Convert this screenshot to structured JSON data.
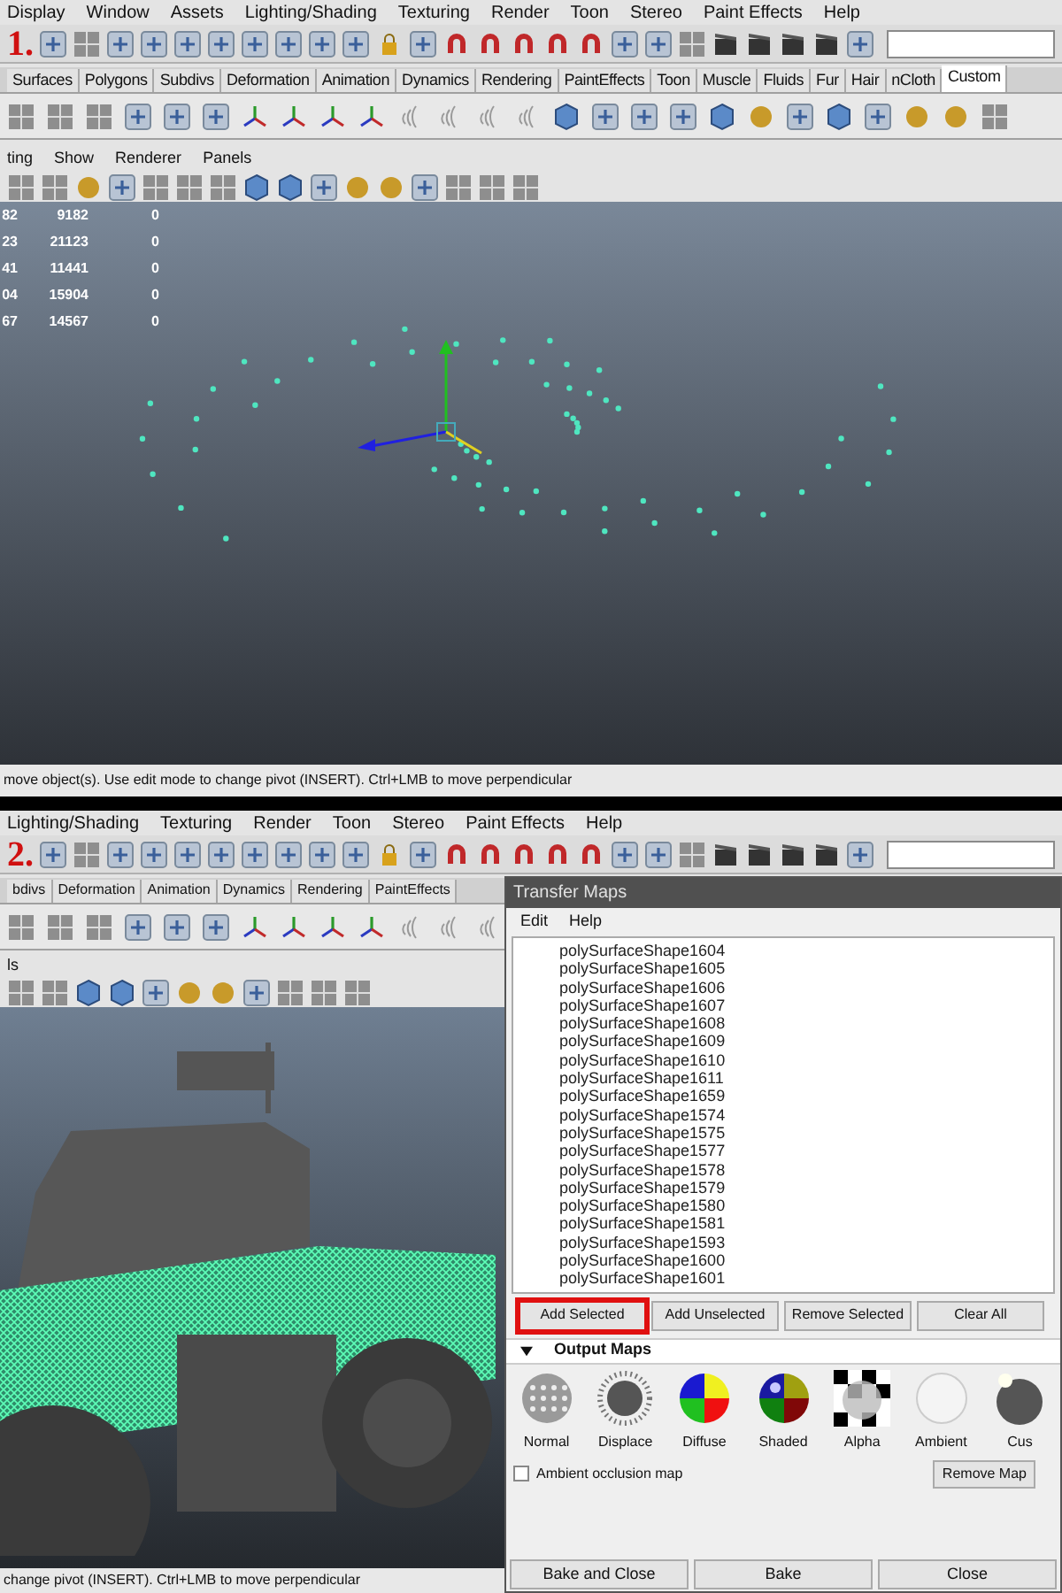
{
  "top_screen": {
    "annotation": "1.",
    "menu_bar": [
      "Display",
      "Window",
      "Assets",
      "Lighting/Shading",
      "Texturing",
      "Render",
      "Toon",
      "Stereo",
      "Paint Effects",
      "Help"
    ],
    "shelf_tabs": [
      {
        "label": "Surfaces",
        "selected": false
      },
      {
        "label": "Polygons",
        "selected": false
      },
      {
        "label": "Subdivs",
        "selected": false
      },
      {
        "label": "Deformation",
        "selected": false
      },
      {
        "label": "Animation",
        "selected": false
      },
      {
        "label": "Dynamics",
        "selected": false
      },
      {
        "label": "Rendering",
        "selected": false
      },
      {
        "label": "PaintEffects",
        "selected": false
      },
      {
        "label": "Toon",
        "selected": false
      },
      {
        "label": "Muscle",
        "selected": false
      },
      {
        "label": "Fluids",
        "selected": false
      },
      {
        "label": "Fur",
        "selected": false
      },
      {
        "label": "Hair",
        "selected": false
      },
      {
        "label": "nCloth",
        "selected": false
      },
      {
        "label": "Custom",
        "selected": true
      }
    ],
    "panel_menu": [
      "ting",
      "Show",
      "Renderer",
      "Panels"
    ],
    "stats_rows": [
      [
        "82",
        "9182",
        "0"
      ],
      [
        "23",
        "21123",
        "0"
      ],
      [
        "41",
        "11441",
        "0"
      ],
      [
        "04",
        "15904",
        "0"
      ],
      [
        "67",
        "14567",
        "0"
      ]
    ],
    "status_line": "move object(s). Use edit mode to change pivot (INSERT).  Ctrl+LMB to move perpendicular"
  },
  "bottom_screen": {
    "annotation": "2.",
    "menu_bar": [
      "Lighting/Shading",
      "Texturing",
      "Render",
      "Toon",
      "Stereo",
      "Paint Effects",
      "Help"
    ],
    "shelf_tabs": [
      {
        "label": "bdivs",
        "selected": false
      },
      {
        "label": "Deformation",
        "selected": false
      },
      {
        "label": "Animation",
        "selected": false
      },
      {
        "label": "Dynamics",
        "selected": false
      },
      {
        "label": "Rendering",
        "selected": false
      },
      {
        "label": "PaintEffects",
        "selected": false
      }
    ],
    "panel_menu": [
      "ls"
    ],
    "status_line": "change pivot (INSERT).  Ctrl+LMB to move perpendicular",
    "transfer_maps": {
      "title": "Transfer Maps",
      "menu": [
        "Edit",
        "Help"
      ],
      "objects": [
        "polySurfaceShape1604",
        "polySurfaceShape1605",
        "polySurfaceShape1606",
        "polySurfaceShape1607",
        "polySurfaceShape1608",
        "polySurfaceShape1609",
        "polySurfaceShape1610",
        "polySurfaceShape1611",
        "polySurfaceShape1659",
        "polySurfaceShape1574",
        "polySurfaceShape1575",
        "polySurfaceShape1577",
        "polySurfaceShape1578",
        "polySurfaceShape1579",
        "polySurfaceShape1580",
        "polySurfaceShape1581",
        "polySurfaceShape1593",
        "polySurfaceShape1600",
        "polySurfaceShape1601"
      ],
      "buttons": [
        {
          "label": "Add Selected",
          "highlighted": true
        },
        {
          "label": "Add Unselected",
          "highlighted": false
        },
        {
          "label": "Remove Selected",
          "highlighted": false
        },
        {
          "label": "Clear All",
          "highlighted": false
        }
      ],
      "output_maps": {
        "title": "Output Maps",
        "expanded": true,
        "maps": [
          {
            "kind": "normal",
            "label": "Normal"
          },
          {
            "kind": "displace",
            "label": "Displace"
          },
          {
            "kind": "diffuse",
            "label": "Diffuse"
          },
          {
            "kind": "shaded",
            "label": "Shaded"
          },
          {
            "kind": "alpha",
            "label": "Alpha"
          },
          {
            "kind": "ambient",
            "label": "Ambient"
          },
          {
            "kind": "custom",
            "label": "Cus"
          }
        ],
        "ambient_occlusion": {
          "label": "Ambient occlusion map",
          "checked": false
        },
        "remove_button": "Remove Map"
      },
      "footer_buttons": [
        "Bake and Close",
        "Bake",
        "Close"
      ]
    }
  }
}
